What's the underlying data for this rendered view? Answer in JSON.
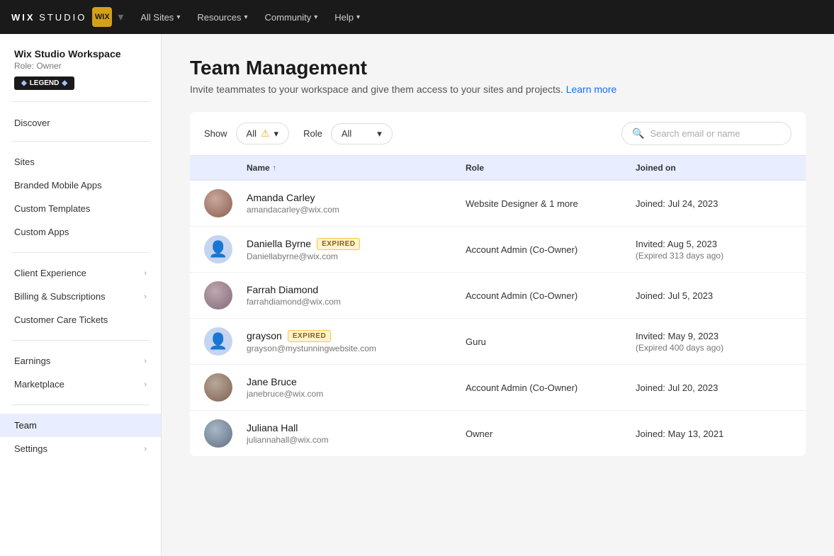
{
  "topnav": {
    "logo_text": "WIX",
    "studio_text": "STUDIO",
    "wix_icon": "WIX",
    "all_sites": "All Sites",
    "resources": "Resources",
    "community": "Community",
    "help": "Help"
  },
  "sidebar": {
    "workspace_title": "Wix Studio Workspace",
    "workspace_role": "Role: Owner",
    "legend_badge": "◆ LEGEND ◆",
    "discover_label": "Discover",
    "items": [
      {
        "id": "sites",
        "label": "Sites",
        "has_arrow": false
      },
      {
        "id": "branded-mobile-apps",
        "label": "Branded Mobile Apps",
        "has_arrow": false
      },
      {
        "id": "custom-templates",
        "label": "Custom Templates",
        "has_arrow": false
      },
      {
        "id": "custom-apps",
        "label": "Custom Apps",
        "has_arrow": false
      },
      {
        "id": "client-experience",
        "label": "Client Experience",
        "has_arrow": true
      },
      {
        "id": "billing-subscriptions",
        "label": "Billing & Subscriptions",
        "has_arrow": true
      },
      {
        "id": "customer-care-tickets",
        "label": "Customer Care Tickets",
        "has_arrow": false
      },
      {
        "id": "earnings",
        "label": "Earnings",
        "has_arrow": true
      },
      {
        "id": "marketplace",
        "label": "Marketplace",
        "has_arrow": true
      },
      {
        "id": "team",
        "label": "Team",
        "has_arrow": false,
        "active": true
      },
      {
        "id": "settings",
        "label": "Settings",
        "has_arrow": true
      }
    ]
  },
  "page": {
    "title": "Team Management",
    "subtitle": "Invite teammates to your workspace and give them access to your sites and projects.",
    "learn_more": "Learn more"
  },
  "filters": {
    "show_label": "Show",
    "show_value": "All",
    "role_label": "Role",
    "role_value": "All",
    "search_placeholder": "Search email or name"
  },
  "table": {
    "columns": {
      "name": "Name",
      "role": "Role",
      "joined": "Joined on"
    },
    "members": [
      {
        "id": "amanda",
        "name": "Amanda Carley",
        "email": "amandacarley@wix.com",
        "role": "Website Designer & 1 more",
        "joined_primary": "Joined: Jul 24, 2023",
        "joined_secondary": "",
        "expired": false,
        "has_photo": true,
        "avatar_style": "avatar-circle-1"
      },
      {
        "id": "daniella",
        "name": "Daniella Byrne",
        "email": "Daniellabyrne@wix.com",
        "role": "Account Admin (Co-Owner)",
        "joined_primary": "Invited: Aug 5, 2023",
        "joined_secondary": "(Expired 313 days ago)",
        "expired": true,
        "has_photo": false,
        "avatar_style": "avatar-circle-2"
      },
      {
        "id": "farrah",
        "name": "Farrah Diamond",
        "email": "farrahdiamond@wix.com",
        "role": "Account Admin (Co-Owner)",
        "joined_primary": "Joined: Jul 5, 2023",
        "joined_secondary": "",
        "expired": false,
        "has_photo": true,
        "avatar_style": "avatar-circle-3"
      },
      {
        "id": "grayson",
        "name": "grayson",
        "email": "grayson@mystunningwebsite.com",
        "role": "Guru",
        "joined_primary": "Invited: May 9, 2023",
        "joined_secondary": "(Expired 400 days ago)",
        "expired": true,
        "has_photo": false,
        "avatar_style": "avatar-circle-4"
      },
      {
        "id": "jane",
        "name": "Jane Bruce",
        "email": "janebruce@wix.com",
        "role": "Account Admin (Co-Owner)",
        "joined_primary": "Joined: Jul 20, 2023",
        "joined_secondary": "",
        "expired": false,
        "has_photo": true,
        "avatar_style": "avatar-circle-5"
      },
      {
        "id": "juliana",
        "name": "Juliana Hall",
        "email": "juliannahall@wix.com",
        "role": "Owner",
        "joined_primary": "Joined: May 13, 2021",
        "joined_secondary": "",
        "expired": false,
        "has_photo": true,
        "avatar_style": "avatar-circle-6"
      }
    ]
  }
}
